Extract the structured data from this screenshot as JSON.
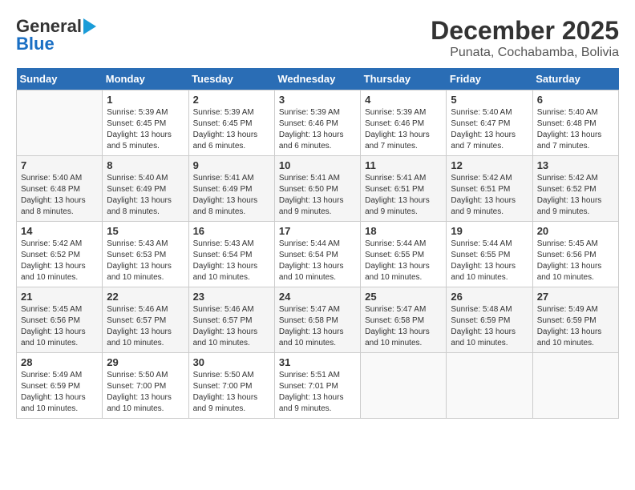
{
  "header": {
    "logo_general": "General",
    "logo_blue": "Blue",
    "month_title": "December 2025",
    "location": "Punata, Cochabamba, Bolivia"
  },
  "weekdays": [
    "Sunday",
    "Monday",
    "Tuesday",
    "Wednesday",
    "Thursday",
    "Friday",
    "Saturday"
  ],
  "weeks": [
    [
      {
        "day": "",
        "info": ""
      },
      {
        "day": "1",
        "info": "Sunrise: 5:39 AM\nSunset: 6:45 PM\nDaylight: 13 hours\nand 5 minutes."
      },
      {
        "day": "2",
        "info": "Sunrise: 5:39 AM\nSunset: 6:45 PM\nDaylight: 13 hours\nand 6 minutes."
      },
      {
        "day": "3",
        "info": "Sunrise: 5:39 AM\nSunset: 6:46 PM\nDaylight: 13 hours\nand 6 minutes."
      },
      {
        "day": "4",
        "info": "Sunrise: 5:39 AM\nSunset: 6:46 PM\nDaylight: 13 hours\nand 7 minutes."
      },
      {
        "day": "5",
        "info": "Sunrise: 5:40 AM\nSunset: 6:47 PM\nDaylight: 13 hours\nand 7 minutes."
      },
      {
        "day": "6",
        "info": "Sunrise: 5:40 AM\nSunset: 6:48 PM\nDaylight: 13 hours\nand 7 minutes."
      }
    ],
    [
      {
        "day": "7",
        "info": "Sunrise: 5:40 AM\nSunset: 6:48 PM\nDaylight: 13 hours\nand 8 minutes."
      },
      {
        "day": "8",
        "info": "Sunrise: 5:40 AM\nSunset: 6:49 PM\nDaylight: 13 hours\nand 8 minutes."
      },
      {
        "day": "9",
        "info": "Sunrise: 5:41 AM\nSunset: 6:49 PM\nDaylight: 13 hours\nand 8 minutes."
      },
      {
        "day": "10",
        "info": "Sunrise: 5:41 AM\nSunset: 6:50 PM\nDaylight: 13 hours\nand 9 minutes."
      },
      {
        "day": "11",
        "info": "Sunrise: 5:41 AM\nSunset: 6:51 PM\nDaylight: 13 hours\nand 9 minutes."
      },
      {
        "day": "12",
        "info": "Sunrise: 5:42 AM\nSunset: 6:51 PM\nDaylight: 13 hours\nand 9 minutes."
      },
      {
        "day": "13",
        "info": "Sunrise: 5:42 AM\nSunset: 6:52 PM\nDaylight: 13 hours\nand 9 minutes."
      }
    ],
    [
      {
        "day": "14",
        "info": "Sunrise: 5:42 AM\nSunset: 6:52 PM\nDaylight: 13 hours\nand 10 minutes."
      },
      {
        "day": "15",
        "info": "Sunrise: 5:43 AM\nSunset: 6:53 PM\nDaylight: 13 hours\nand 10 minutes."
      },
      {
        "day": "16",
        "info": "Sunrise: 5:43 AM\nSunset: 6:54 PM\nDaylight: 13 hours\nand 10 minutes."
      },
      {
        "day": "17",
        "info": "Sunrise: 5:44 AM\nSunset: 6:54 PM\nDaylight: 13 hours\nand 10 minutes."
      },
      {
        "day": "18",
        "info": "Sunrise: 5:44 AM\nSunset: 6:55 PM\nDaylight: 13 hours\nand 10 minutes."
      },
      {
        "day": "19",
        "info": "Sunrise: 5:44 AM\nSunset: 6:55 PM\nDaylight: 13 hours\nand 10 minutes."
      },
      {
        "day": "20",
        "info": "Sunrise: 5:45 AM\nSunset: 6:56 PM\nDaylight: 13 hours\nand 10 minutes."
      }
    ],
    [
      {
        "day": "21",
        "info": "Sunrise: 5:45 AM\nSunset: 6:56 PM\nDaylight: 13 hours\nand 10 minutes."
      },
      {
        "day": "22",
        "info": "Sunrise: 5:46 AM\nSunset: 6:57 PM\nDaylight: 13 hours\nand 10 minutes."
      },
      {
        "day": "23",
        "info": "Sunrise: 5:46 AM\nSunset: 6:57 PM\nDaylight: 13 hours\nand 10 minutes."
      },
      {
        "day": "24",
        "info": "Sunrise: 5:47 AM\nSunset: 6:58 PM\nDaylight: 13 hours\nand 10 minutes."
      },
      {
        "day": "25",
        "info": "Sunrise: 5:47 AM\nSunset: 6:58 PM\nDaylight: 13 hours\nand 10 minutes."
      },
      {
        "day": "26",
        "info": "Sunrise: 5:48 AM\nSunset: 6:59 PM\nDaylight: 13 hours\nand 10 minutes."
      },
      {
        "day": "27",
        "info": "Sunrise: 5:49 AM\nSunset: 6:59 PM\nDaylight: 13 hours\nand 10 minutes."
      }
    ],
    [
      {
        "day": "28",
        "info": "Sunrise: 5:49 AM\nSunset: 6:59 PM\nDaylight: 13 hours\nand 10 minutes."
      },
      {
        "day": "29",
        "info": "Sunrise: 5:50 AM\nSunset: 7:00 PM\nDaylight: 13 hours\nand 10 minutes."
      },
      {
        "day": "30",
        "info": "Sunrise: 5:50 AM\nSunset: 7:00 PM\nDaylight: 13 hours\nand 9 minutes."
      },
      {
        "day": "31",
        "info": "Sunrise: 5:51 AM\nSunset: 7:01 PM\nDaylight: 13 hours\nand 9 minutes."
      },
      {
        "day": "",
        "info": ""
      },
      {
        "day": "",
        "info": ""
      },
      {
        "day": "",
        "info": ""
      }
    ]
  ]
}
